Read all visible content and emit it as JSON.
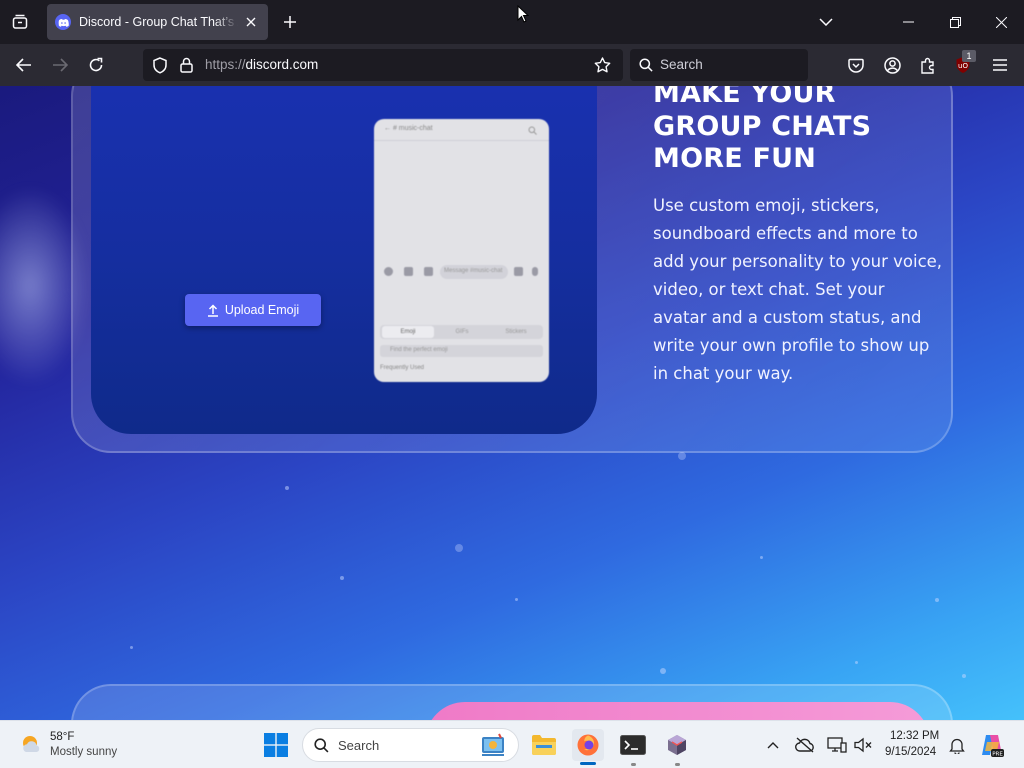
{
  "browser": {
    "tab": {
      "title": "Discord - Group Chat That’s All Fun & Games",
      "favicon": "discord-icon"
    },
    "url_scheme": "https://",
    "url_host": "discord.com",
    "search_placeholder": "Search",
    "extension_badge": "1"
  },
  "page": {
    "upload_button_label": "Upload Emoji",
    "phone": {
      "header": "←  # music-chat",
      "message_placeholder": "Message #music-chat",
      "tabs": [
        "Emoji",
        "GIFs",
        "Stickers"
      ],
      "search_placeholder": "Find the perfect emoji",
      "footer": "Frequently Used"
    },
    "heading_lines": [
      "MAKE YOUR",
      "GROUP CHATS",
      "MORE FUN"
    ],
    "description": "Use custom emoji, stickers, soundboard effects and more to add your personality to your voice, video, or text chat. Set your avatar and a custom status, and write your own profile to show up in chat your way."
  },
  "taskbar": {
    "weather_temp": "58°F",
    "weather_desc": "Mostly sunny",
    "search_label": "Search",
    "time": "12:32 PM",
    "date": "9/15/2024"
  },
  "colors": {
    "discord_blurple": "#5865f2",
    "chrome_dark": "#1c1b22",
    "toolbar": "#2b2a33",
    "taskbar": "#eef2f7",
    "accent_pink": "#ef7ac7"
  }
}
